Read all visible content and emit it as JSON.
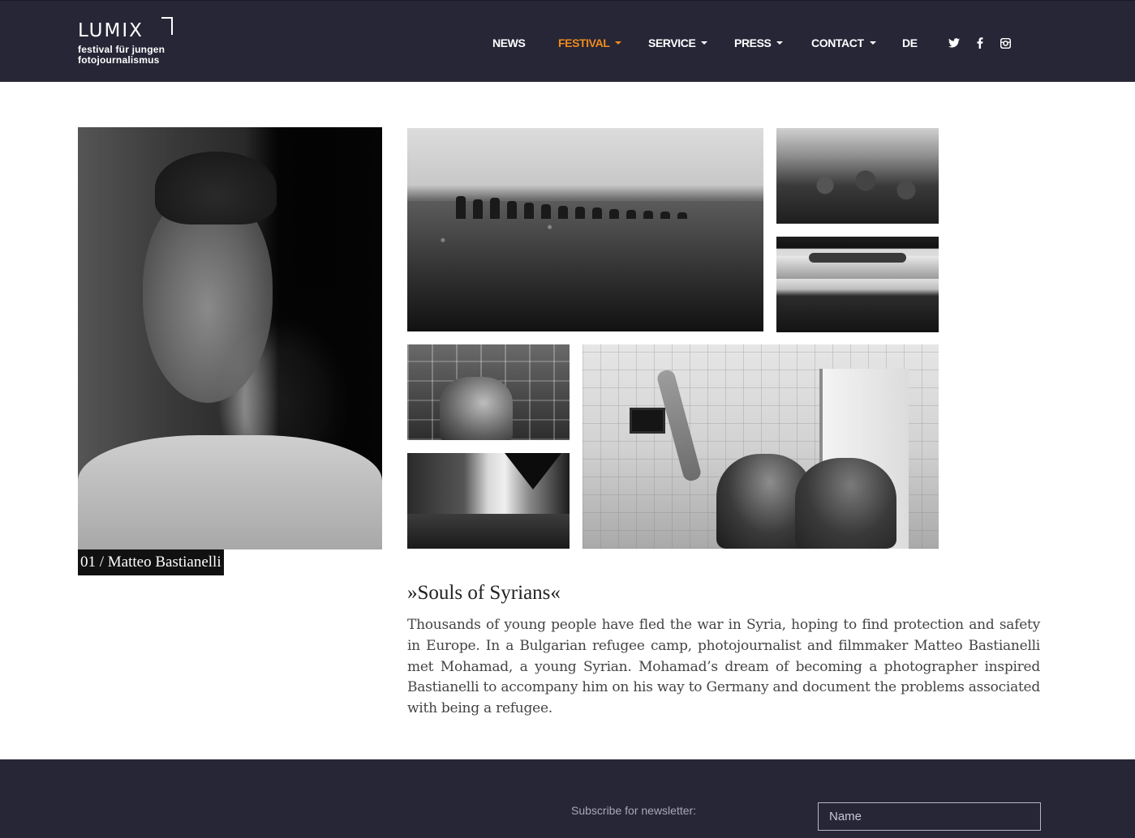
{
  "header": {
    "logo": {
      "word": "LUMIX",
      "line1": "festival für jungen",
      "line2": "fotojournalismus"
    },
    "nav": [
      {
        "label": "NEWS",
        "dropdown": false,
        "active": false
      },
      {
        "label": "FESTIVAL",
        "dropdown": true,
        "active": true
      },
      {
        "label": "SERVICE",
        "dropdown": true,
        "active": false
      },
      {
        "label": "PRESS",
        "dropdown": true,
        "active": false
      },
      {
        "label": "CONTACT",
        "dropdown": true,
        "active": false
      },
      {
        "label": "DE",
        "dropdown": false,
        "active": false
      }
    ],
    "social": [
      "twitter-icon",
      "facebook-icon",
      "instagram-icon"
    ]
  },
  "portrait": {
    "caption": "01 / Matteo Bastianelli"
  },
  "article": {
    "title": "»Souls of Syrians«",
    "body": "Thousands of young people have fled the war in Syria, hoping to find protection and safety in Europe. In a Bulgarian refugee camp, photojournalist and filmmaker Matteo Bastianelli met Mohamad, a young Syrian. Mohamad’s dream of becoming a photographer inspired Bastianelli to accompany him on his way to Germany and document the problems associated with being a refugee."
  },
  "footer": {
    "newsletter_label": "Subscribe for newsletter:",
    "name_placeholder": "Name"
  },
  "colors": {
    "header_bg": "#262637",
    "accent": "#f08a1c",
    "text": "#444444"
  }
}
